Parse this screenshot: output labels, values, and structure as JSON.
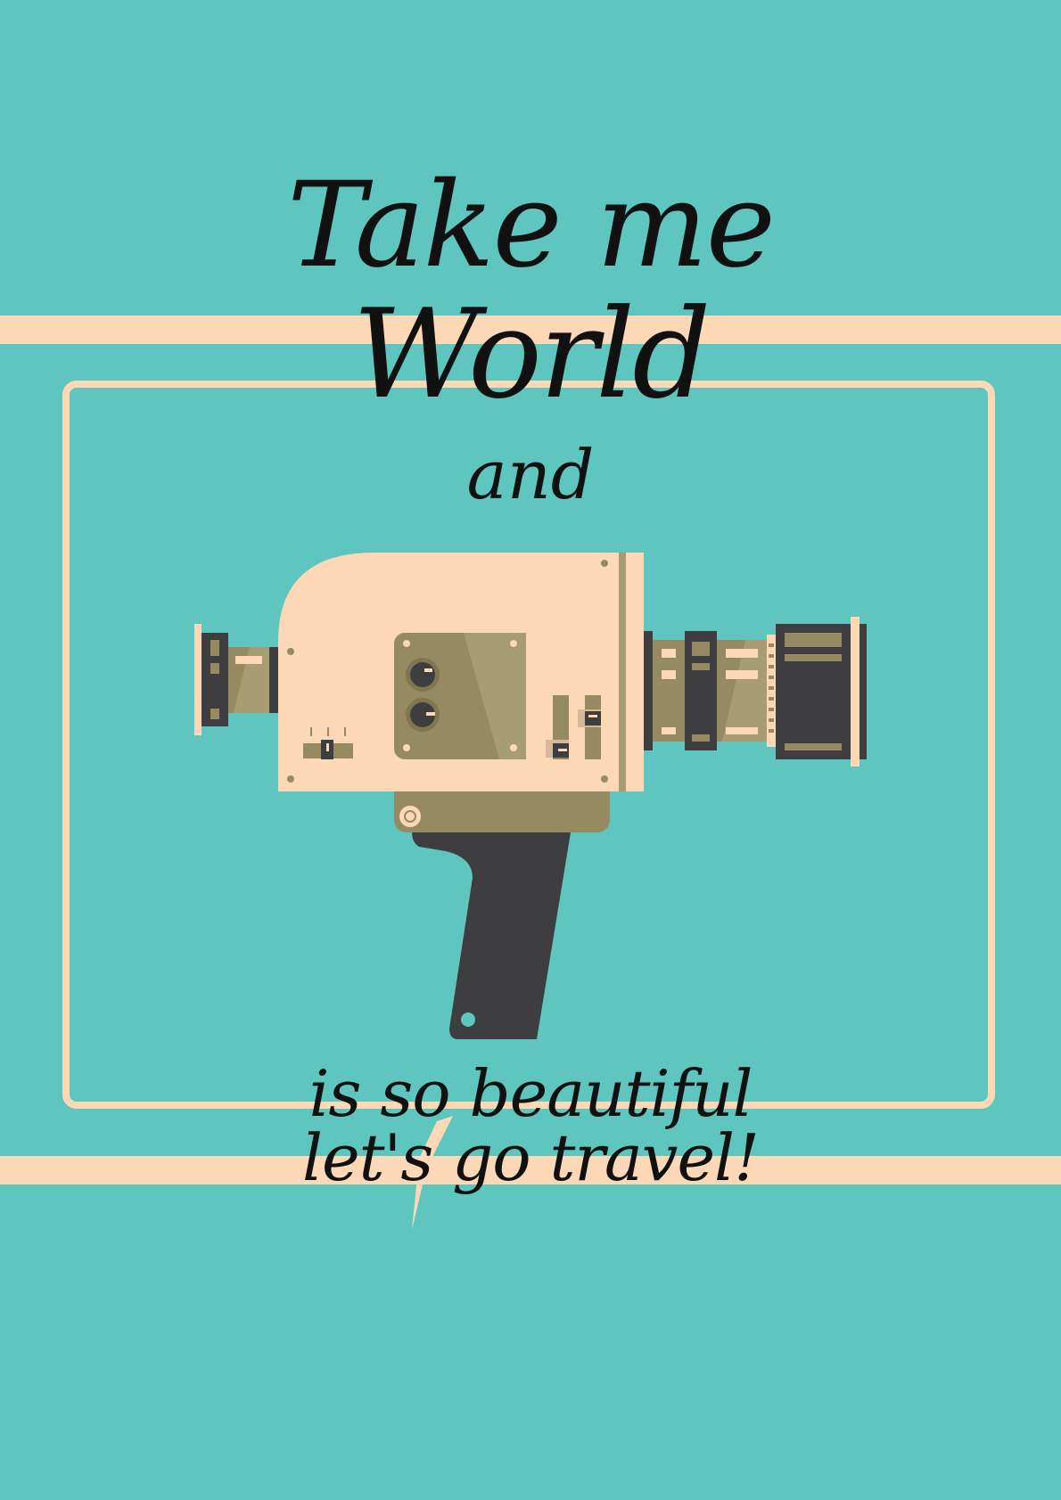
{
  "poster": {
    "title_line1": "Take me",
    "title_line2": "World",
    "title_and": "and",
    "caption_line1": "is so beautiful",
    "caption_line2": "let's go travel!"
  },
  "illustration": {
    "subject": "movie-camera-icon"
  },
  "colors": {
    "background": "#5fc5bf",
    "cream": "#fcd8b6",
    "olive": "#968a62",
    "dark": "#3e3d40",
    "ink": "#111111"
  }
}
